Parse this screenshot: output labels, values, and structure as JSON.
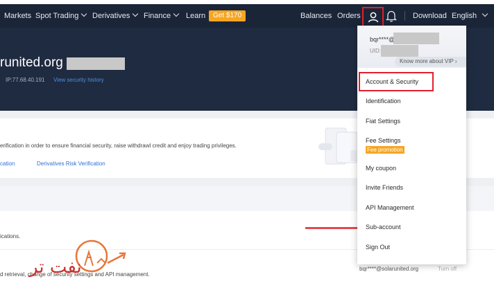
{
  "nav": {
    "items": [
      {
        "label": "Markets",
        "dropdown": false
      },
      {
        "label": "Spot Trading",
        "dropdown": true
      },
      {
        "label": "Derivatives",
        "dropdown": true
      },
      {
        "label": "Finance",
        "dropdown": true
      },
      {
        "label": "Learn",
        "dropdown": false
      }
    ],
    "promo_label": "Get $170",
    "balances": "Balances",
    "orders": "Orders",
    "download": "Download",
    "language": "English"
  },
  "hero": {
    "domain": "runited.org",
    "ip": "IP:77.68.40.191",
    "history_link": "View security history"
  },
  "verification": {
    "description": "erification in order to ensure financial security, raise withdrawl credit and enjoy trading privileges.",
    "link_identity": "cation",
    "link_derivatives": "Derivatives Risk Verification"
  },
  "rows": {
    "notifications_text": "ications.",
    "retrieval_text": "d retrieval, change of security settings and API management.",
    "email": "bqr****@solarunited.org",
    "toggle_label": "Turn off"
  },
  "watermark": {
    "text": "نفت تر"
  },
  "dropdown": {
    "user": "bqr****@",
    "uid_label": "UID:",
    "vip_label": "Know more about VIP",
    "items": [
      {
        "label": "Account & Security"
      },
      {
        "label": "Identification"
      },
      {
        "label": "Fiat Settings"
      },
      {
        "label": "Fee Settings"
      },
      {
        "label": "My coupon"
      },
      {
        "label": "Invite Friends"
      },
      {
        "label": "API Management"
      },
      {
        "label": "Sub-account"
      },
      {
        "label": "Sign Out"
      }
    ],
    "fee_badge": "Fee promotion"
  },
  "colors": {
    "nav_bg": "#1b2538",
    "hero_bg": "#1f2b40",
    "accent_orange": "#f5a623",
    "link_blue": "#2f6fd6",
    "highlight_red": "#e0202b"
  },
  "icons": {
    "user": "user-icon",
    "bell": "bell-icon",
    "vip_chevron": "chevron-right-icon"
  }
}
